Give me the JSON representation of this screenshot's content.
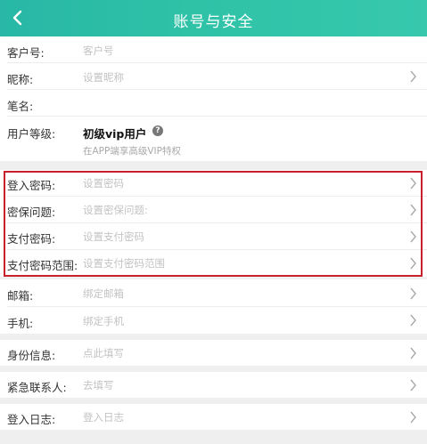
{
  "header": {
    "title": "账号与安全"
  },
  "rows": {
    "customer_no": {
      "label": "客户号:",
      "value": "客户号"
    },
    "nickname": {
      "label": "昵称:",
      "value": "设置昵称"
    },
    "pen_name": {
      "label": "笔名:",
      "value": ""
    },
    "user_level": {
      "label": "用户等级:",
      "level": "初级vip用户",
      "help_glyph": "?",
      "note": "在APP端享高级VIP特权"
    },
    "login_password": {
      "label": "登入密码:",
      "value": "设置密码"
    },
    "security_question": {
      "label": "密保问题:",
      "value": "设置密保问题:"
    },
    "payment_password": {
      "label": "支付密码:",
      "value": "设置支付密码"
    },
    "payment_password_range": {
      "label": "支付密码范围:",
      "value": "设置支付密码范围"
    },
    "email": {
      "label": "邮箱:",
      "value": "绑定邮箱"
    },
    "phone": {
      "label": "手机:",
      "value": "绑定手机"
    },
    "identity": {
      "label": "身份信息:",
      "value": "点此填写"
    },
    "emergency_contact": {
      "label": "紧急联系人:",
      "value": "去填写"
    },
    "login_log": {
      "label": "登入日志:",
      "value": "登入日志"
    }
  },
  "icons": {
    "back": "back-arrow-icon",
    "chevron": "chevron-right-icon",
    "help": "help-icon"
  },
  "colors": {
    "header": "#2fc2a7",
    "highlight_border": "#c8212b",
    "background": "#efefef"
  }
}
